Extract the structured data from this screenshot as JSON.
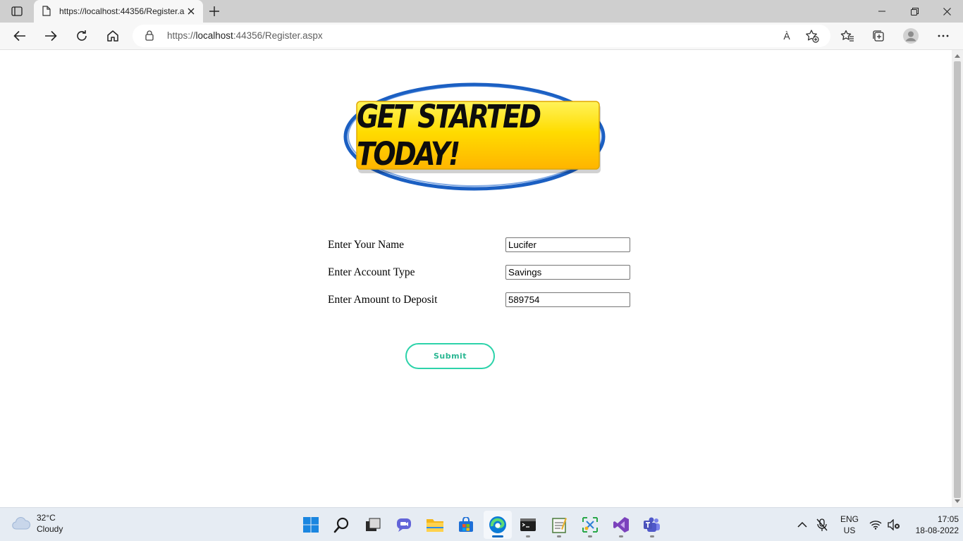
{
  "browser": {
    "tab_title": "https://localhost:44356/Register.aspx",
    "url_prefix": "https://",
    "url_host": "localhost",
    "url_rest": ":44356/Register.aspx",
    "read_aloud_label": "À"
  },
  "page": {
    "banner_text": "GET STARTED TODAY!",
    "fields": {
      "name_label": "Enter Your Name",
      "name_value": "Lucifer",
      "account_label": "Enter Account Type",
      "account_value": "Savings",
      "amount_label": "Enter Amount to Deposit",
      "amount_value": "589754"
    },
    "submit_label": "Submit",
    "colors": {
      "banner_yellow": "#ffd400",
      "banner_ring": "#1b5fc2",
      "submit_accent": "#2dd3aa"
    }
  },
  "taskbar": {
    "weather_temp": "32°C",
    "weather_desc": "Cloudy",
    "lang_top": "ENG",
    "lang_bottom": "US",
    "time": "17:05",
    "date": "18-08-2022"
  }
}
